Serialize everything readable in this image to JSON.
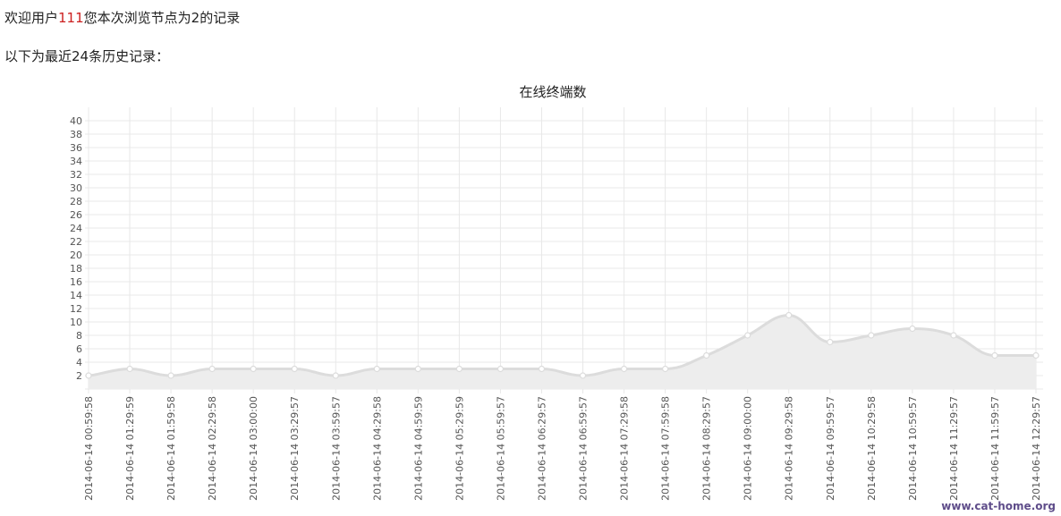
{
  "header": {
    "welcome_prefix": "欢迎用户",
    "user_id": "111",
    "welcome_middle": "您本次浏览节点为",
    "node_id": "2",
    "welcome_suffix": "的记录",
    "history_text": "以下为最近24条历史记录："
  },
  "colors": {
    "highlight": "#cc2020",
    "line": "#dcdcdc",
    "fill": "#ededed",
    "point": "#ffffff",
    "grid": "#e8e8e8",
    "text": "#555555"
  },
  "chart_data": {
    "type": "area",
    "title": "在线终端数",
    "xlabel": "",
    "ylabel": "",
    "ylim": [
      0,
      40
    ],
    "yticks": [
      2,
      4,
      6,
      8,
      10,
      12,
      14,
      16,
      18,
      20,
      22,
      24,
      26,
      28,
      30,
      32,
      34,
      36,
      38,
      40
    ],
    "grid": true,
    "legend": "none",
    "categories": [
      "2014-06-14 00:59:58",
      "2014-06-14 01:29:59",
      "2014-06-14 01:59:58",
      "2014-06-14 02:29:58",
      "2014-06-14 03:00:00",
      "2014-06-14 03:29:57",
      "2014-06-14 03:59:57",
      "2014-06-14 04:29:58",
      "2014-06-14 04:59:59",
      "2014-06-14 05:29:59",
      "2014-06-14 05:59:57",
      "2014-06-14 06:29:57",
      "2014-06-14 06:59:57",
      "2014-06-14 07:29:58",
      "2014-06-14 07:59:58",
      "2014-06-14 08:29:57",
      "2014-06-14 09:00:00",
      "2014-06-14 09:29:58",
      "2014-06-14 09:59:57",
      "2014-06-14 10:29:58",
      "2014-06-14 10:59:57",
      "2014-06-14 11:29:57",
      "2014-06-14 11:59:57",
      "2014-06-14 12:29:57"
    ],
    "values": [
      2,
      3,
      2,
      3,
      3,
      3,
      2,
      3,
      3,
      3,
      3,
      3,
      2,
      3,
      3,
      5,
      8,
      11,
      7,
      8,
      9,
      8,
      5,
      5
    ]
  },
  "watermark": "www.cat-home.org"
}
